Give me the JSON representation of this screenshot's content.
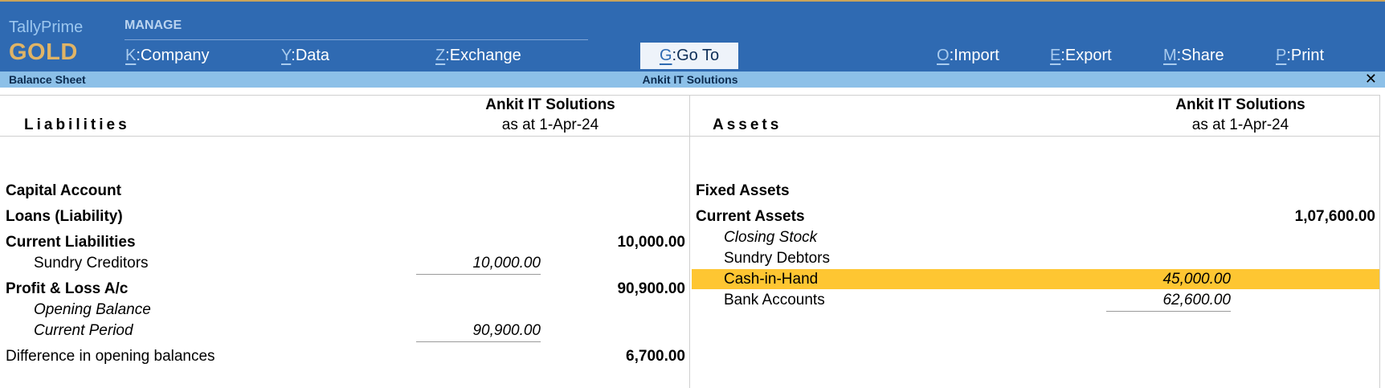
{
  "brand": {
    "product": "TallyPrime",
    "edition": "GOLD"
  },
  "menu": {
    "section_label": "MANAGE",
    "items": [
      {
        "key": "K",
        "label": "Company"
      },
      {
        "key": "Y",
        "label": "Data"
      },
      {
        "key": "Z",
        "label": "Exchange"
      },
      {
        "key": "G",
        "label": "Go To"
      },
      {
        "key": "O",
        "label": "Import"
      },
      {
        "key": "E",
        "label": "Export"
      },
      {
        "key": "M",
        "label": "Share"
      },
      {
        "key": "P",
        "label": "Print"
      }
    ]
  },
  "titlebar": {
    "report": "Balance Sheet",
    "company": "Ankit IT Solutions",
    "close_glyph": "✕"
  },
  "liabilities": {
    "heading": "Liabilities",
    "company": "Ankit IT Solutions",
    "as_at": "as at 1-Apr-24",
    "rows": [
      {
        "label": "Capital Account",
        "sub": "",
        "total": ""
      },
      {
        "label": "Loans (Liability)",
        "sub": "",
        "total": ""
      },
      {
        "label": "Current Liabilities",
        "sub": "",
        "total": "10,000.00"
      },
      {
        "label": "Sundry Creditors",
        "sub": "10,000.00",
        "total": ""
      },
      {
        "label": "Profit & Loss A/c",
        "sub": "",
        "total": "90,900.00"
      },
      {
        "label": "Opening Balance",
        "sub": "",
        "total": ""
      },
      {
        "label": "Current Period",
        "sub": "90,900.00",
        "total": ""
      },
      {
        "label": "Difference in opening balances",
        "sub": "",
        "total": "6,700.00"
      }
    ]
  },
  "assets": {
    "heading": "Assets",
    "company": "Ankit IT Solutions",
    "as_at": "as at 1-Apr-24",
    "rows": [
      {
        "label": "Fixed Assets",
        "sub": "",
        "total": ""
      },
      {
        "label": "Current Assets",
        "sub": "",
        "total": "1,07,600.00"
      },
      {
        "label": "Closing Stock",
        "sub": "",
        "total": ""
      },
      {
        "label": "Sundry Debtors",
        "sub": "",
        "total": ""
      },
      {
        "label": "Cash-in-Hand",
        "sub": "45,000.00",
        "total": "",
        "selected": true
      },
      {
        "label": "Bank Accounts",
        "sub": "62,600.00",
        "total": ""
      }
    ]
  },
  "colors": {
    "header_bg": "#2f6ab2",
    "titlebar_bg": "#8cc0e8",
    "brand_gold": "#e0b466",
    "selection_bg": "#fec632"
  }
}
